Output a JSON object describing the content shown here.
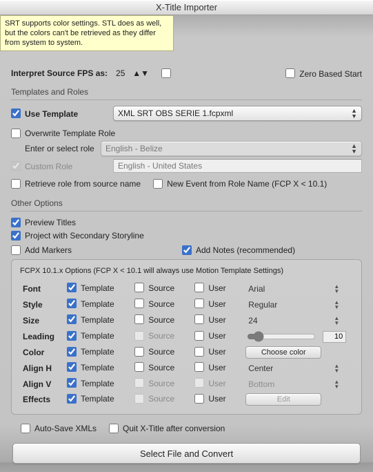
{
  "window": {
    "title": "X-Title Importer"
  },
  "tooltip": "SRT supports color settings. STL does as well, but the colors can't be retrieved as they differ from system to system.",
  "timing": {
    "interpret_label": "Interpret Source FPS as:",
    "fps": "25",
    "zero_based_label": "Zero Based Start"
  },
  "templates": {
    "section": "Templates and Roles",
    "use_template_label": "Use Template",
    "template_selected": "XML SRT OBS SERIE 1.fcpxml",
    "overwrite_label": "Overwrite Template Role",
    "enter_role_label": "Enter or select role",
    "role_selected": "English - Belize",
    "custom_role_label": "Custom Role",
    "custom_role_value": "English - United States",
    "retrieve_label": "Retrieve role from source name",
    "new_event_label": "New Event from Role Name (FCP X < 10.1)"
  },
  "other": {
    "section": "Other Options",
    "preview_label": "Preview Titles",
    "secondary_label": "Project with Secondary Storyline",
    "markers_label": "Add Markers",
    "notes_label": "Add Notes (recommended)"
  },
  "fcpx": {
    "panel_title": "FCPX 10.1.x Options (FCP X < 10.1 will always use Motion Template Settings)",
    "col_template": "Template",
    "col_source": "Source",
    "col_user": "User",
    "rows": {
      "font": {
        "label": "Font",
        "value": "Arial"
      },
      "style": {
        "label": "Style",
        "value": "Regular"
      },
      "size": {
        "label": "Size",
        "value": "24"
      },
      "leading": {
        "label": "Leading",
        "value": "10"
      },
      "color": {
        "label": "Color",
        "button": "Choose color"
      },
      "alignh": {
        "label": "Align H",
        "value": "Center"
      },
      "alignv": {
        "label": "Align V",
        "value": "Bottom"
      },
      "effects": {
        "label": "Effects",
        "button": "Edit"
      }
    }
  },
  "footer": {
    "autosave_label": "Auto-Save XMLs",
    "quit_label": "Quit X-Title after conversion",
    "convert_button": "Select File and Convert"
  }
}
